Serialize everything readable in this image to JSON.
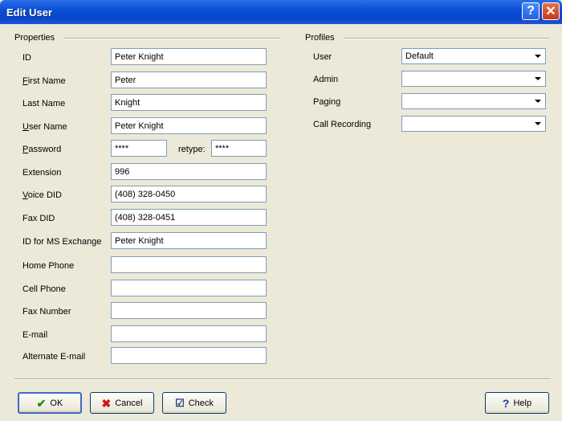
{
  "window": {
    "title": "Edit User",
    "help_glyph": "?",
    "close_glyph": "✕"
  },
  "properties": {
    "group_label": "Properties",
    "fields": [
      {
        "label_mn": "",
        "label_rest": "ID",
        "value": "Peter Knight"
      },
      {
        "label_mn": "F",
        "label_rest": "irst Name",
        "value": "Peter"
      },
      {
        "label_mn": "",
        "label_rest": "Last Name",
        "value": "Knight"
      },
      {
        "label_mn": "U",
        "label_rest": "ser Name",
        "value": "Peter Knight"
      },
      {
        "label_mn": "P",
        "label_rest": "assword",
        "value": "****"
      },
      {
        "label_mn": "",
        "label_rest": "Extension",
        "value": "996"
      },
      {
        "label_mn": "V",
        "label_rest": "oice DID",
        "value": "(408) 328-0450"
      },
      {
        "label_mn": "",
        "label_rest": "Fax DID",
        "value": "(408) 328-0451"
      },
      {
        "label_mn": "",
        "label_rest": "ID for MS Exchange",
        "value": "Peter Knight"
      },
      {
        "label_mn": "",
        "label_rest": "Home Phone",
        "value": ""
      },
      {
        "label_mn": "",
        "label_rest": "Cell Phone",
        "value": ""
      },
      {
        "label_mn": "",
        "label_rest": "Fax Number",
        "value": ""
      },
      {
        "label_mn": "",
        "label_rest": "E-mail",
        "value": ""
      },
      {
        "label_mn": "",
        "label_rest": "Alternate E-mail",
        "value": ""
      }
    ],
    "retype_label": "retype:",
    "retype_value": "****"
  },
  "profiles": {
    "group_label": "Profiles",
    "items": [
      {
        "label": "User",
        "value": "Default"
      },
      {
        "label": "Admin",
        "value": ""
      },
      {
        "label": "Paging",
        "value": ""
      },
      {
        "label": "Call Recording",
        "value": ""
      }
    ]
  },
  "buttons": {
    "ok": "OK",
    "cancel": "Cancel",
    "check": "Check",
    "help": "Help"
  },
  "icons": {
    "ok": "check-icon",
    "cancel": "x-icon",
    "check": "check-doc-icon",
    "help": "question-icon"
  }
}
